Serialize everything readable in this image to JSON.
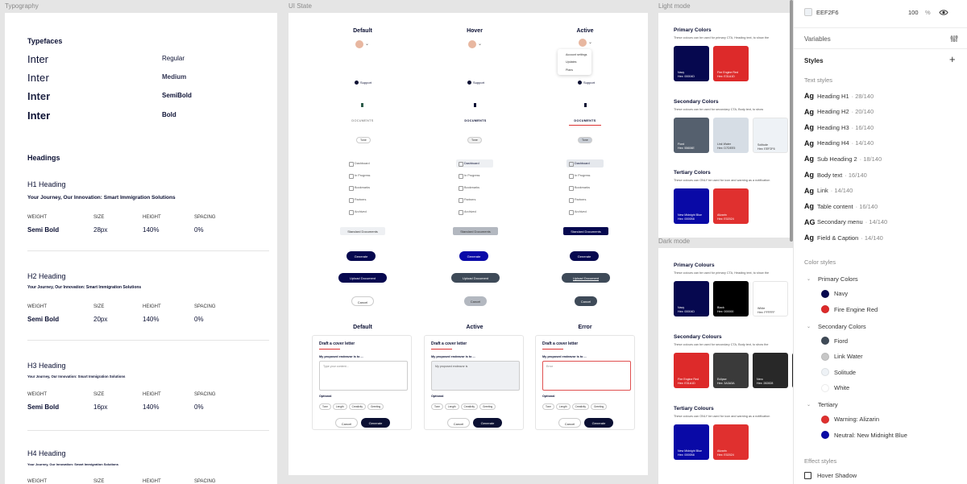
{
  "frames": {
    "typography": "Typography",
    "ui_state": "UI State",
    "light_mode": "Light mode",
    "dark_mode": "Dark mode"
  },
  "typo": {
    "typefaces_title": "Typefaces",
    "faces": [
      {
        "name": "Inter",
        "weight": "Regular"
      },
      {
        "name": "Inter",
        "weight": "Medium"
      },
      {
        "name": "Inter",
        "weight": "SemiBold"
      },
      {
        "name": "Inter",
        "weight": "Bold"
      }
    ],
    "headings_title": "Headings",
    "metric_heads": [
      "WEIGHT",
      "SIZE",
      "HEIGHT",
      "SPACING"
    ],
    "headings": [
      {
        "name": "H1 Heading",
        "sample": "Your Journey, Our Innovation: Smart Immigration Solutions",
        "weight": "Semi Bold",
        "size": "28px",
        "height": "140%",
        "spacing": "0%"
      },
      {
        "name": "H2 Heading",
        "sample": "Your Journey, Our Innovation: Smart Immigration Solutions",
        "weight": "Semi Bold",
        "size": "20px",
        "height": "140%",
        "spacing": "0%"
      },
      {
        "name": "H3 Heading",
        "sample": "Your Journey, Our Innovation: Smart Immigration Solutions",
        "weight": "Semi Bold",
        "size": "16px",
        "height": "140%",
        "spacing": "0%"
      },
      {
        "name": "H4 Heading",
        "sample": "Your Journey, Our Innovation: Smart Immigration Solutions",
        "weight": "",
        "size": "",
        "height": "",
        "spacing": ""
      }
    ]
  },
  "ui": {
    "states": [
      "Default",
      "Hover",
      "Active"
    ],
    "support": "Support",
    "documents": "DOCUMENTS",
    "tone": "Tone",
    "nav": [
      "Dashboard",
      "In Progress",
      "Bookmarks",
      "Partners",
      "Archived"
    ],
    "standard_docs": "Standard Documents",
    "generate": "Generate",
    "upload": "Upload Document",
    "cancel": "Cancel",
    "menu": [
      "Account settings",
      "Updates",
      "Plans"
    ],
    "form_states": [
      "Default",
      "Active",
      "Error"
    ],
    "form": {
      "title": "Draft a cover letter",
      "question": "My proposed endeavor is to ...",
      "placeholders": [
        "Type your content...",
        "My proposed endeavor is",
        "Error"
      ],
      "optional": "Optional",
      "chips": [
        "Tone",
        "Length",
        "Creativity",
        "Greeting"
      ],
      "cancel": "Cancel",
      "generate": "Generate"
    }
  },
  "light": {
    "primary_title": "Primary Colors",
    "primary_desc": "These colours can be used for primary CTA, Heading text, to show the",
    "primary": [
      {
        "name": "Navy",
        "hex": "Hex: 00004D",
        "color": "#06084f",
        "text": "#ffffff"
      },
      {
        "name": "Fire Engine Red",
        "hex": "Hex: E31A1D",
        "color": "#dd2a2a",
        "text": "#ffffff"
      }
    ],
    "secondary_title": "Secondary Colors",
    "secondary_desc": "These colours can be used for secondary CTA, Body text, to show",
    "secondary": [
      {
        "name": "Fiord",
        "hex": "Hex: 55606E",
        "color": "#55606e",
        "text": "#ffffff"
      },
      {
        "name": "Link Water",
        "hex": "Hex: D7DEE5",
        "color": "#d6dde5",
        "text": "#333333"
      },
      {
        "name": "Solitude",
        "hex": "Hex: EEF2F6",
        "color": "#eef2f6",
        "text": "#333333"
      }
    ],
    "tertiary_title": "Tertiary Colors",
    "tertiary_desc": "These colours can ONLY be used for icon and warning as a notification",
    "tertiary": [
      {
        "name": "New Midnight Blue",
        "hex": "Hex: 0000B8",
        "color": "#0909a6",
        "text": "#ffffff"
      },
      {
        "name": "Alizarin",
        "hex": "Hex: E02024",
        "color": "#e0302f",
        "text": "#ffffff"
      }
    ]
  },
  "dark": {
    "primary_title": "Primary Colours",
    "primary_desc": "These colours can be used for primary CTA, Heading text, to show the",
    "primary": [
      {
        "name": "Navy",
        "hex": "Hex: 00004D",
        "color": "#06084f",
        "text": "#ffffff"
      },
      {
        "name": "Black",
        "hex": "Hex: 000000",
        "color": "#000000",
        "text": "#ffffff"
      },
      {
        "name": "White",
        "hex": "Hex: FFFFFF",
        "color": "#ffffff",
        "text": "#333333"
      }
    ],
    "secondary_title": "Secondary Colours",
    "secondary_desc": "These colours can be used for secondary CTA, Body text, to show the",
    "secondary": [
      {
        "name": "Fire Engine Red",
        "hex": "Hex: E31A1D",
        "color": "#dd2a2a",
        "text": "#ffffff"
      },
      {
        "name": "Eclipse",
        "hex": "Hex: 3A3A3A",
        "color": "#3a3a3a",
        "text": "#ffffff"
      },
      {
        "name": "Nero",
        "hex": "Hex: 282828",
        "color": "#282828",
        "text": "#ffffff"
      },
      {
        "name": "",
        "hex": "",
        "color": "#1e1e1e",
        "text": "#ffffff"
      }
    ],
    "tertiary_title": "Tertiary Colours",
    "tertiary_desc": "These colours can ONLY be used for icon and warning as a notification",
    "tertiary": [
      {
        "name": "New Midnight Blue",
        "hex": "Hex: 0000B8",
        "color": "#0909a6",
        "text": "#ffffff"
      },
      {
        "name": "Alizarin",
        "hex": "Hex: E02024",
        "color": "#e0302f",
        "text": "#ffffff"
      }
    ]
  },
  "panel": {
    "fill_hex": "EEF2F6",
    "opacity": "100",
    "percent": "%",
    "variables": "Variables",
    "styles": "Styles",
    "text_styles": "Text styles",
    "text_items": [
      {
        "ag": "Ag",
        "name": "Heading H1",
        "meta": "· 28/140"
      },
      {
        "ag": "Ag",
        "name": "Heading H2",
        "meta": "· 20/140"
      },
      {
        "ag": "Ag",
        "name": "Heading H3",
        "meta": "· 16/140"
      },
      {
        "ag": "Ag",
        "name": "Heading H4",
        "meta": "· 14/140"
      },
      {
        "ag": "Ag",
        "name": "Sub Heading 2",
        "meta": "· 18/140"
      },
      {
        "ag": "Ag",
        "name": "Body text",
        "meta": "· 16/140"
      },
      {
        "ag": "Ag",
        "name": "Link",
        "meta": "· 14/140"
      },
      {
        "ag": "Ag",
        "name": "Table content",
        "meta": "· 16/140"
      },
      {
        "ag": "AG",
        "name": "Secondary menu",
        "meta": "· 14/140"
      },
      {
        "ag": "Ag",
        "name": "Field & Caption",
        "meta": "· 14/140"
      }
    ],
    "color_styles": "Color styles",
    "groups": [
      {
        "name": "Primary Colors",
        "items": [
          {
            "name": "Navy",
            "color": "#06084f"
          },
          {
            "name": "Fire Engine Red",
            "color": "#dd2a2a"
          }
        ]
      },
      {
        "name": "Secondary Colors",
        "items": [
          {
            "name": "Fiord",
            "color": "#3f4a57"
          },
          {
            "name": "Link Water",
            "color": "#c7c7c7"
          },
          {
            "name": "Solitude",
            "color": "#eef2f6"
          },
          {
            "name": "White",
            "color": "#ffffff"
          }
        ]
      },
      {
        "name": "Tertiary",
        "items": [
          {
            "name": "Warning: Alizarin",
            "color": "#e0302f"
          },
          {
            "name": "Neutral: New Midnight Blue",
            "color": "#0909a6"
          }
        ]
      }
    ],
    "effect_styles": "Effect styles",
    "effects": [
      "Hover Shadow"
    ]
  }
}
